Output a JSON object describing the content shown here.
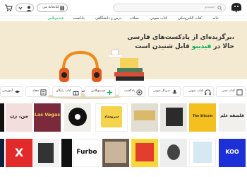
{
  "header": {
    "logo_text": "فیدیبو",
    "search_placeholder": "جستجو",
    "library_label": "کتابخانهٔ من",
    "user_icon": "user-icon",
    "cart_icon": "cart-icon"
  },
  "nav": {
    "items": [
      "خانه",
      "کتاب الکترونیکی",
      "کتاب صوتی",
      "مجلات",
      "درس و دانشگاهی",
      "پادکست",
      "فیدیبوپلاس"
    ],
    "active_index": 6,
    "active_color": "#00aa55"
  },
  "subbar": {
    "text": "دانلود اپلیکیشن"
  },
  "hero": {
    "line1": "برگزیده‌ای از پادکست‌های فارسی،",
    "line2_prefix": "حالا در ",
    "line2_brand": "فیدیبو",
    "line2_suffix": " قابل شنیدن است",
    "background": "#f4ead2"
  },
  "categories": [
    {
      "label": "کتاب متنی",
      "icon": "book-icon"
    },
    {
      "label": "کتاب صوتی",
      "icon": "headphones-icon"
    },
    {
      "label": "سریال صوتی",
      "icon": "mic-icon"
    },
    {
      "label": "پادکست",
      "icon": "podcast-icon"
    },
    {
      "label": "فیدیبوپلاس",
      "icon": "plus-icon"
    },
    {
      "label": "کتاب رایگان",
      "icon": "gift-icon"
    },
    {
      "label": "مجله",
      "icon": "magazine-icon"
    },
    {
      "label": "آموزشی",
      "icon": "education-icon"
    }
  ],
  "row1": [
    {
      "bg": "#f2f0ec",
      "text": "فلسفه علم",
      "color": "#222"
    },
    {
      "bg": "#f3c01f",
      "text": "The Sitcom",
      "color": "#222"
    },
    {
      "bg": "#e8e6e0",
      "text": "",
      "color": "#222"
    },
    {
      "bg": "#e2ded4",
      "text": "",
      "color": "#222"
    },
    {
      "bg": "#ffffff",
      "text": "سروشاد",
      "color": "#222"
    },
    {
      "bg": "#f0efe9",
      "text": "",
      "color": "#222"
    },
    {
      "bg": "#c9c7bf",
      "text": "",
      "color": "#222"
    },
    {
      "bg": "#7a2a3a",
      "text": "Las Vegas",
      "color": "#f3d35b"
    },
    {
      "bg": "#f3dede",
      "text": "من، زن",
      "color": "#222"
    },
    {
      "bg": "#ffffff",
      "text": "",
      "color": "#222"
    }
  ],
  "row2": [
    {
      "bg": "#1d2fd6",
      "text": "KOO",
      "color": "#ffffff"
    },
    {
      "bg": "#ffffff",
      "text": "",
      "color": "#222"
    },
    {
      "bg": "#eeeeee",
      "text": "",
      "color": "#222"
    },
    {
      "bg": "#f7d73a",
      "text": "",
      "color": "#222"
    },
    {
      "bg": "#6b5b4f",
      "text": "",
      "color": "#222"
    },
    {
      "bg": "#ffffff",
      "text": "Furbo",
      "color": "#111"
    },
    {
      "bg": "#111111",
      "text": "",
      "color": "#ffffff"
    },
    {
      "bg": "#f2f2f2",
      "text": "",
      "color": "#222"
    },
    {
      "bg": "#e22a2a",
      "text": "X",
      "color": "#ffffff"
    },
    {
      "bg": "#0d1f3c",
      "text": "",
      "color": "#ffffff"
    }
  ]
}
